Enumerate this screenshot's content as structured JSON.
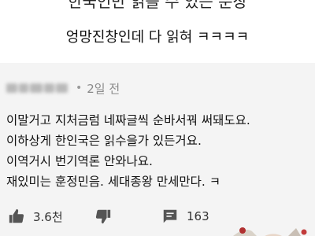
{
  "header": {
    "headline": "한국인만 읽을 수 있는 문장",
    "subline": "엉망진창인데 다 읽혀 ㅋㅋㅋㅋ"
  },
  "comment": {
    "time_ago": "2일 전",
    "lines": [
      "이말거고 지처금럼 네짜글씩 순바서꿔 써돼도요.",
      "이하상게 한인국은 읽수을가 있든거요.",
      "이역거시 번기역론 안와나요.",
      "재있미는 훈정민음. 세대종왕 만세만다. ㅋ"
    ],
    "likes": "3.6천",
    "replies": "163"
  },
  "icons": {
    "like": "thumbs-up-icon",
    "dislike": "thumbs-down-icon",
    "reply": "reply-comment-icon"
  },
  "colors": {
    "comment_bg": "#f4f4f4",
    "icon": "#555555"
  }
}
